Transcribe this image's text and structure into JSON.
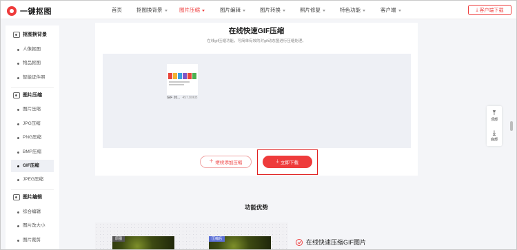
{
  "brand": {
    "name": "一键抠图",
    "accent": "#ee3b3b"
  },
  "nav": {
    "items": [
      {
        "label": "首页",
        "has_caret": false
      },
      {
        "label": "抠图换背景",
        "has_caret": true
      },
      {
        "label": "图片压缩",
        "has_caret": true,
        "active": true
      },
      {
        "label": "图片编辑",
        "has_caret": true
      },
      {
        "label": "图片转换",
        "has_caret": true
      },
      {
        "label": "照片修复",
        "has_caret": true
      },
      {
        "label": "特色功能",
        "has_caret": true
      },
      {
        "label": "客户端",
        "has_caret": true
      }
    ],
    "client_download": "客户端下载"
  },
  "sidebar": {
    "groups": [
      {
        "label": "抠图换背景",
        "icon": "image-icon",
        "items": [
          "人像抠图",
          "物品抠图",
          "智能证件照"
        ]
      },
      {
        "label": "图片压缩",
        "icon": "image-icon",
        "items": [
          "图片压缩",
          "JPG压缩",
          "PNG压缩",
          "BMP压缩",
          "GIF压缩",
          "JPEG压缩"
        ],
        "active_item": "GIF压缩"
      },
      {
        "label": "图片编辑",
        "icon": "image-icon",
        "items": [
          "综合编辑",
          "图片改大小",
          "图片裁剪"
        ]
      }
    ]
  },
  "main": {
    "title": "在线快速GIF压缩",
    "subtitle": "在线gif压缩功能，可简单有效的对gif动态图进行压缩处理。",
    "file": {
      "name": "GIF 20...",
      "size": "457.80KB"
    },
    "add_button": "继续添加压缩",
    "download_button": "立即下载"
  },
  "float": {
    "top_label": "顶部",
    "bottom_label": "底部"
  },
  "features": {
    "title": "功能优势",
    "photo_before": "原图",
    "photo_after": "压缩后",
    "item_1": "在线快速压缩GIF图片"
  }
}
